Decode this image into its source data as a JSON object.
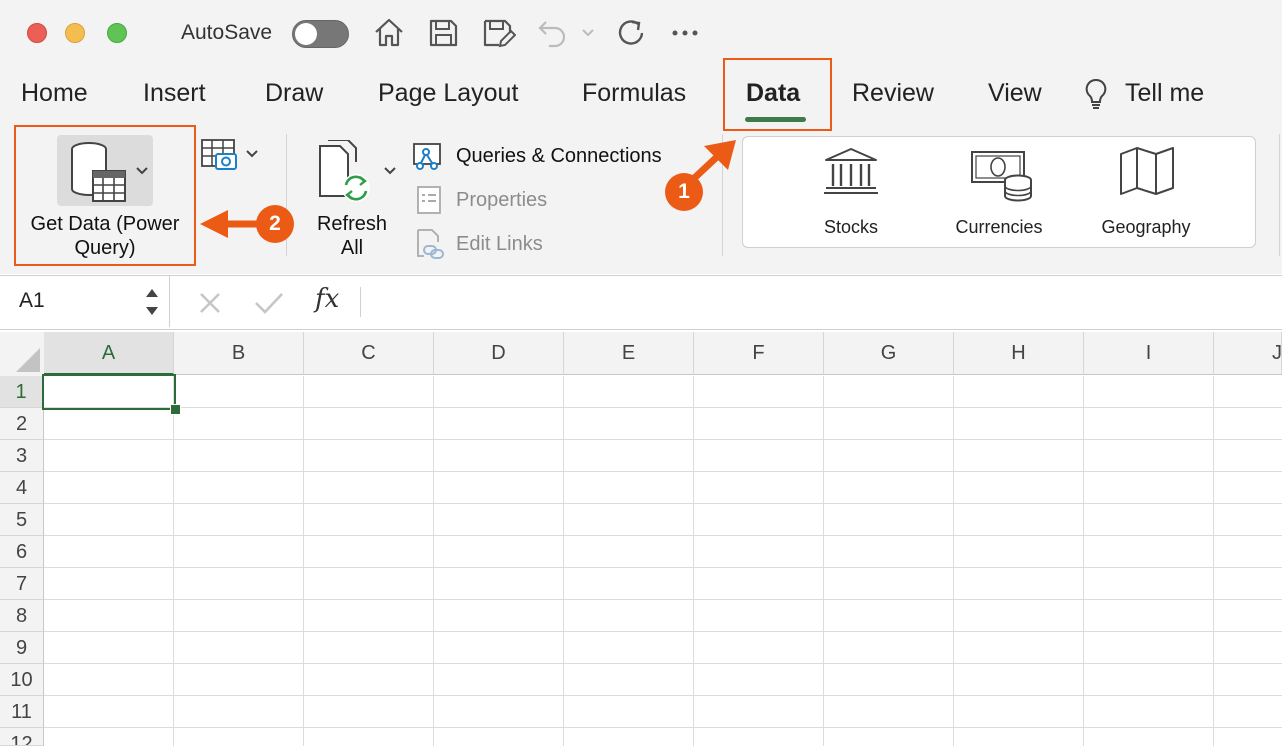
{
  "titlebar": {
    "autosave_label": "AutoSave",
    "autosave_state": "off",
    "quick_access_icons": [
      "home-icon",
      "save-icon",
      "save-as-icon",
      "undo-icon",
      "undo-dropdown-icon",
      "redo-icon",
      "more-icon"
    ]
  },
  "tabs": [
    {
      "label": "Home"
    },
    {
      "label": "Insert"
    },
    {
      "label": "Draw"
    },
    {
      "label": "Page Layout"
    },
    {
      "label": "Formulas"
    },
    {
      "label": "Data",
      "active": true
    },
    {
      "label": "Review"
    },
    {
      "label": "View"
    },
    {
      "label": "Tell me"
    }
  ],
  "ribbon": {
    "get_data": {
      "line1": "Get Data (Power",
      "line2": "Query)"
    },
    "refresh_all": {
      "line1": "Refresh",
      "line2": "All"
    },
    "queries_connections": "Queries & Connections",
    "properties": "Properties",
    "edit_links": "Edit Links",
    "data_types": [
      "Stocks",
      "Currencies",
      "Geography"
    ]
  },
  "formula_bar": {
    "name_box": "A1",
    "fx_label": "fx",
    "content": ""
  },
  "grid": {
    "columns": [
      "A",
      "B",
      "C",
      "D",
      "E",
      "F",
      "G",
      "H",
      "I",
      "J"
    ],
    "rows": [
      "1",
      "2",
      "3",
      "4",
      "5",
      "6",
      "7",
      "8",
      "9",
      "10",
      "11",
      "12"
    ],
    "selected_cell": "A1"
  },
  "annotations": {
    "step1": "1",
    "step2": "2",
    "accent_color": "#ec5b16"
  },
  "colors": {
    "ribbon_bg": "#f3f3f3",
    "excel_green": "#3f7a4a"
  }
}
